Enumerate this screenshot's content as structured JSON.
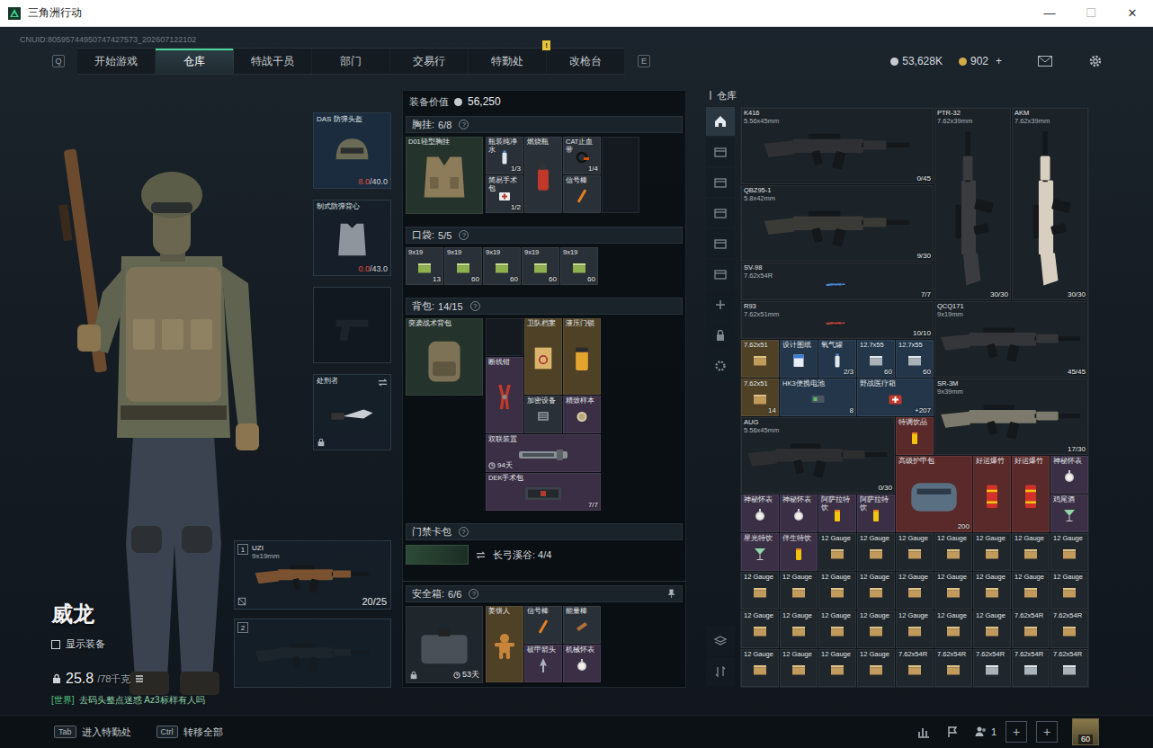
{
  "window": {
    "title": "三角洲行动",
    "controls": [
      {
        "glyph": "—",
        "kind": "minimize",
        "disabled": false
      },
      {
        "glyph": "☐",
        "kind": "maximize",
        "disabled": true
      },
      {
        "glyph": "✕",
        "kind": "close",
        "disabled": false
      }
    ]
  },
  "uid": "CNUID:80595744950747427573_202607122102",
  "nav": {
    "prev_key": "Q",
    "next_key": "E",
    "tabs": [
      {
        "label": "开始游戏",
        "selected": false,
        "badge": ""
      },
      {
        "label": "仓库",
        "selected": true,
        "badge": ""
      },
      {
        "label": "特战干员",
        "selected": false,
        "badge": ""
      },
      {
        "label": "部门",
        "selected": false,
        "badge": ""
      },
      {
        "label": "交易行",
        "selected": false,
        "badge": ""
      },
      {
        "label": "特勤处",
        "selected": false,
        "badge": "!"
      },
      {
        "label": "改枪台",
        "selected": false,
        "badge": ""
      }
    ]
  },
  "currencies": [
    {
      "value": "53,628K",
      "kind": "silver",
      "action": ""
    },
    {
      "value": "902",
      "kind": "gold",
      "action": "+"
    }
  ],
  "operator": {
    "name": "威龙",
    "show_gear": {
      "label": "显示装备",
      "checked": false
    },
    "load": "25.8",
    "max_load": "/78千克",
    "chat": {
      "channel": "[世界]",
      "text": "去码头整点迷惑 Az3标样有人吗"
    }
  },
  "equipment": {
    "helmet": {
      "name": "DAS 防弹头盔",
      "kind": "helmet",
      "durability": "8.0",
      "max": "/40.0",
      "low": true
    },
    "armor": {
      "name": "制式防弹背心",
      "kind": "vest",
      "durability": "0.0",
      "max": "/43.0",
      "low": true
    },
    "pistol": {
      "kind": "pistol",
      "empty": true
    },
    "melee": {
      "name": "处刑者",
      "kind": "knife",
      "locked": true
    },
    "weapons": [
      {
        "slot": "1",
        "name": "UZI",
        "caliber": "9x19mm",
        "ammo": "20/25",
        "empty": false,
        "insured": false,
        "kind": "weapon",
        "skin": "#7a5232"
      },
      {
        "slot": "2",
        "name": "",
        "caliber": "",
        "ammo": "",
        "empty": true,
        "insured": true,
        "kind": "weapon",
        "skin": ""
      }
    ]
  },
  "loadout": {
    "value_label": "装备价值",
    "value": "56,250",
    "help": "?",
    "chest": {
      "title": "胸挂:",
      "count": "6/8",
      "main": {
        "name": "D01轻型胸挂",
        "count": "",
        "kind": "rig",
        "color": "#25332d"
      },
      "items": [
        {
          "name": "瓶装纯净水",
          "count": "1/3",
          "kind": "bottle",
          "color": "#2a3037"
        },
        {
          "name": "燃烧瓶",
          "count": "",
          "kind": "extinguisher",
          "color": "#2a3037"
        },
        {
          "name": "CAT止血带",
          "count": "1/4",
          "kind": "strap",
          "color": "#2a3037"
        },
        {
          "name": "简易手术包",
          "count": "1/2",
          "kind": "kit",
          "color": "#2a3037"
        },
        {
          "name": "信号棒",
          "count": "",
          "kind": "flare",
          "color": "#2a3037"
        },
        {
          "name": "",
          "count": "",
          "kind": "empty",
          "color": "#141a20"
        }
      ]
    },
    "pockets": {
      "title": "口袋:",
      "count": "5/5",
      "items": [
        {
          "name": "9x19",
          "count": "13",
          "kind": "ammo-green",
          "color": "#2a3037"
        },
        {
          "name": "9x19",
          "count": "60",
          "kind": "ammo-green",
          "color": "#2a3037"
        },
        {
          "name": "9x19",
          "count": "60",
          "kind": "ammo-green",
          "color": "#2a3037"
        },
        {
          "name": "9x19",
          "count": "60",
          "kind": "ammo-green",
          "color": "#2a3037"
        },
        {
          "name": "9x19",
          "count": "60",
          "kind": "ammo-green",
          "color": "#2a3037"
        }
      ]
    },
    "backpack": {
      "title": "背包:",
      "count": "14/15",
      "main": {
        "name": "突袭战术背包",
        "count": "",
        "kind": "backpack",
        "color": "#25332d"
      },
      "items": [
        {
          "name": "",
          "count": "",
          "kind": "empty",
          "color": "#141a20"
        },
        {
          "name": "卫队档案",
          "count": "",
          "kind": "doc",
          "color": "#4e4126"
        },
        {
          "name": "液压门锁",
          "count": "",
          "kind": "pump",
          "color": "#4e4126"
        },
        {
          "name": "断线钳",
          "count": "",
          "kind": "tool",
          "color": "#3a2f45"
        },
        {
          "name": "加密设备",
          "count": "",
          "kind": "device",
          "color": "#2a3037"
        },
        {
          "name": "精致样本",
          "count": "",
          "kind": "sample",
          "color": "#3a2f45"
        },
        {
          "name": "双联装置",
          "count": "",
          "kind": "case",
          "color": "#3a2f45",
          "timer": "94天"
        },
        {
          "name": "DEK手术包",
          "count": "7/7",
          "kind": "kitcase",
          "color": "#3a2f45"
        }
      ]
    },
    "keycard": {
      "title": "门禁卡包",
      "card": "长弓溪谷: 4/4"
    },
    "safe": {
      "title": "安全箱:",
      "count": "6/6",
      "box": {
        "kind": "safe",
        "color": "#1f262c",
        "locked": true,
        "timer": "53天"
      },
      "items": [
        {
          "name": "姜饼人",
          "count": "",
          "kind": "cookie",
          "color": "#4e4126"
        },
        {
          "name": "信号棒",
          "count": "",
          "kind": "flare",
          "color": "#2a3037"
        },
        {
          "name": "能量棒",
          "count": "",
          "kind": "bar",
          "color": "#2a3037"
        },
        {
          "name": "破甲箭头",
          "count": "",
          "kind": "arrow",
          "color": "#3a2f45"
        },
        {
          "name": "机械怀表",
          "count": "",
          "kind": "watch",
          "color": "#3a2f45"
        }
      ]
    }
  },
  "warehouse": {
    "title": "仓库",
    "tabs": [
      {
        "kind": "home",
        "selected": true
      },
      {
        "kind": "box",
        "selected": false
      },
      {
        "kind": "box",
        "selected": false
      },
      {
        "kind": "box",
        "selected": false
      },
      {
        "kind": "box",
        "selected": false
      },
      {
        "kind": "box",
        "selected": false
      },
      {
        "kind": "plus",
        "selected": false
      },
      {
        "kind": "lock",
        "selected": false
      },
      {
        "kind": "gear",
        "selected": false
      }
    ],
    "tools": [
      {
        "kind": "layers"
      },
      {
        "kind": "sort"
      }
    ],
    "items": [
      {
        "name": "K416",
        "sub": "5.56x45mm",
        "count": "0/45",
        "kind": "weapon",
        "color": "#1b2228",
        "skin": "#2e3033"
      },
      {
        "name": "PTR-32",
        "sub": "7.62x39mm",
        "count": "30/30",
        "kind": "weapon",
        "color": "#1b2228",
        "skin": "#3a3c3f"
      },
      {
        "name": "AKM",
        "sub": "7.62x39mm",
        "count": "30/30",
        "kind": "weapon",
        "color": "#1b2228",
        "skin": "#d9cfc0"
      },
      {
        "name": "QBZ95-1",
        "sub": "5.8x42mm",
        "count": "9/30",
        "kind": "weapon",
        "color": "#1b2228",
        "skin": "#3a3a36"
      },
      {
        "name": "SV-98",
        "sub": "7.62x54R",
        "count": "7/7",
        "kind": "weapon",
        "color": "#1b2228",
        "skin": "#4a86d8"
      },
      {
        "name": "R93",
        "sub": "7.62x51mm",
        "count": "10/10",
        "kind": "weapon",
        "color": "#1b2228",
        "skin": "#b8413a"
      },
      {
        "name": "QCQ171",
        "sub": "9x19mm",
        "count": "45/45",
        "kind": "weapon",
        "color": "#1b2228",
        "skin": "#34363a"
      },
      {
        "name": "7.62x51",
        "sub": "",
        "count": "",
        "kind": "ammo",
        "color": "#4e4126"
      },
      {
        "name": "设计图纸",
        "sub": "",
        "count": "",
        "kind": "paper",
        "color": "#23364a"
      },
      {
        "name": "氧气罐",
        "sub": "",
        "count": "2/3",
        "kind": "bottle",
        "color": "#23364a"
      },
      {
        "name": "12.7x55",
        "sub": "",
        "count": "60",
        "kind": "ammo-silver",
        "color": "#23364a"
      },
      {
        "name": "12.7x55",
        "sub": "",
        "count": "60",
        "kind": "ammo-silver",
        "color": "#23364a"
      },
      {
        "name": "7.62x51",
        "sub": "",
        "count": "14",
        "kind": "ammo",
        "color": "#4e4126"
      },
      {
        "name": "HK3便携电池",
        "sub": "",
        "count": "8",
        "kind": "battery",
        "color": "#23364a"
      },
      {
        "name": "野战医疗箱",
        "sub": "",
        "count": "+207",
        "kind": "medkit",
        "color": "#23364a"
      },
      {
        "name": "SR-3M",
        "sub": "9x39mm",
        "count": "17/30",
        "kind": "weapon",
        "color": "#1b2228",
        "skin": "#7c7a6c"
      },
      {
        "name": "AUG",
        "sub": "5.56x45mm",
        "count": "0/30",
        "kind": "weapon",
        "color": "#1b2228",
        "skin": "#2c2e30"
      },
      {
        "name": "特调饮品",
        "sub": "",
        "count": "",
        "kind": "drink",
        "color": "#5a2a2a"
      },
      {
        "name": "高级护甲包",
        "sub": "",
        "count": "200",
        "kind": "bag",
        "color": "#5a2a2a"
      },
      {
        "name": "好运爆竹",
        "sub": "",
        "count": "",
        "kind": "firecracker",
        "color": "#5a2a2a"
      },
      {
        "name": "好运爆竹",
        "sub": "",
        "count": "",
        "kind": "firecracker",
        "color": "#5a2a2a"
      },
      {
        "name": "神秘怀表",
        "sub": "",
        "count": "",
        "kind": "watch",
        "color": "#3a2f45"
      },
      {
        "name": "神秘怀表",
        "sub": "",
        "count": "",
        "kind": "watch",
        "color": "#3a2f45"
      },
      {
        "name": "神秘怀表",
        "sub": "",
        "count": "",
        "kind": "watch",
        "color": "#3a2f45"
      },
      {
        "name": "阿萨拉特饮",
        "sub": "",
        "count": "",
        "kind": "drink",
        "color": "#3a2f45"
      },
      {
        "name": "阿萨拉特饮",
        "sub": "",
        "count": "",
        "kind": "drink",
        "color": "#3a2f45"
      },
      {
        "name": "鸡尾酒",
        "sub": "",
        "count": "",
        "kind": "cocktail",
        "color": "#3a2f45"
      },
      {
        "name": "星光特饮",
        "sub": "",
        "count": "",
        "kind": "cocktail",
        "color": "#3a2f45"
      },
      {
        "name": "伴生特饮",
        "sub": "",
        "count": "",
        "kind": "drink",
        "color": "#3a2f45"
      },
      {
        "name": "12 Gauge",
        "sub": "",
        "count": "",
        "kind": "ammo",
        "color": "#1f262c"
      },
      {
        "name": "12 Gauge",
        "sub": "",
        "count": "",
        "kind": "ammo",
        "color": "#1f262c"
      },
      {
        "name": "12 Gauge",
        "sub": "",
        "count": "",
        "kind": "ammo",
        "color": "#1f262c"
      },
      {
        "name": "12 Gauge",
        "sub": "",
        "count": "",
        "kind": "ammo",
        "color": "#1f262c"
      },
      {
        "name": "12 Gauge",
        "sub": "",
        "count": "",
        "kind": "ammo",
        "color": "#1f262c"
      },
      {
        "name": "12 Gauge",
        "sub": "",
        "count": "",
        "kind": "ammo",
        "color": "#1f262c"
      },
      {
        "name": "12 Gauge",
        "sub": "",
        "count": "",
        "kind": "ammo",
        "color": "#1f262c"
      },
      {
        "name": "12 Gauge",
        "sub": "",
        "count": "",
        "kind": "ammo",
        "color": "#1f262c"
      },
      {
        "name": "12 Gauge",
        "sub": "",
        "count": "",
        "kind": "ammo",
        "color": "#1f262c"
      },
      {
        "name": "12 Gauge",
        "sub": "",
        "count": "",
        "kind": "ammo",
        "color": "#1f262c"
      },
      {
        "name": "12 Gauge",
        "sub": "",
        "count": "",
        "kind": "ammo",
        "color": "#1f262c"
      },
      {
        "name": "12 Gauge",
        "sub": "",
        "count": "",
        "kind": "ammo",
        "color": "#1f262c"
      },
      {
        "name": "12 Gauge",
        "sub": "",
        "count": "",
        "kind": "ammo",
        "color": "#1f262c"
      },
      {
        "name": "12 Gauge",
        "sub": "",
        "count": "",
        "kind": "ammo",
        "color": "#1f262c"
      },
      {
        "name": "12 Gauge",
        "sub": "",
        "count": "",
        "kind": "ammo",
        "color": "#1f262c"
      },
      {
        "name": "12 Gauge",
        "sub": "",
        "count": "",
        "kind": "ammo",
        "color": "#1f262c"
      },
      {
        "name": "12 Gauge",
        "sub": "",
        "count": "",
        "kind": "ammo",
        "color": "#1f262c"
      },
      {
        "name": "12 Gauge",
        "sub": "",
        "count": "",
        "kind": "ammo",
        "color": "#1f262c"
      },
      {
        "name": "12 Gauge",
        "sub": "",
        "count": "",
        "kind": "ammo",
        "color": "#1f262c"
      },
      {
        "name": "12 Gauge",
        "sub": "",
        "count": "",
        "kind": "ammo",
        "color": "#1f262c"
      },
      {
        "name": "12 Gauge",
        "sub": "",
        "count": "",
        "kind": "ammo",
        "color": "#1f262c"
      },
      {
        "name": "12 Gauge",
        "sub": "",
        "count": "",
        "kind": "ammo",
        "color": "#1f262c"
      },
      {
        "name": "12 Gauge",
        "sub": "",
        "count": "",
        "kind": "ammo",
        "color": "#1f262c"
      },
      {
        "name": "7.62x54R",
        "sub": "",
        "count": "",
        "kind": "ammo",
        "color": "#1f262c"
      },
      {
        "name": "7.62x54R",
        "sub": "",
        "count": "",
        "kind": "ammo",
        "color": "#1f262c"
      },
      {
        "name": "12 Gauge",
        "sub": "",
        "count": "",
        "kind": "ammo",
        "color": "#1f262c"
      },
      {
        "name": "12 Gauge",
        "sub": "",
        "count": "",
        "kind": "ammo",
        "color": "#1f262c"
      },
      {
        "name": "12 Gauge",
        "sub": "",
        "count": "",
        "kind": "ammo",
        "color": "#1f262c"
      },
      {
        "name": "12 Gauge",
        "sub": "",
        "count": "",
        "kind": "ammo",
        "color": "#1f262c"
      },
      {
        "name": "7.62x54R",
        "sub": "",
        "count": "",
        "kind": "ammo",
        "color": "#1f262c"
      },
      {
        "name": "7.62x54R",
        "sub": "",
        "count": "",
        "kind": "ammo",
        "color": "#1f262c"
      },
      {
        "name": "7.62x54R",
        "sub": "",
        "count": "",
        "kind": "ammo-silver",
        "color": "#1f262c"
      },
      {
        "name": "7.62x54R",
        "sub": "",
        "count": "",
        "kind": "ammo-silver",
        "color": "#1f262c"
      },
      {
        "name": "7.62x54R",
        "sub": "",
        "count": "",
        "kind": "ammo-silver",
        "color": "#1f262c"
      }
    ]
  },
  "footer": {
    "hints": [
      {
        "key": "Tab",
        "label": "进入特勤处"
      },
      {
        "key": "Ctrl",
        "label": "转移全部"
      }
    ],
    "party": "1",
    "slots": [
      "+",
      "+"
    ],
    "level": "60"
  }
}
